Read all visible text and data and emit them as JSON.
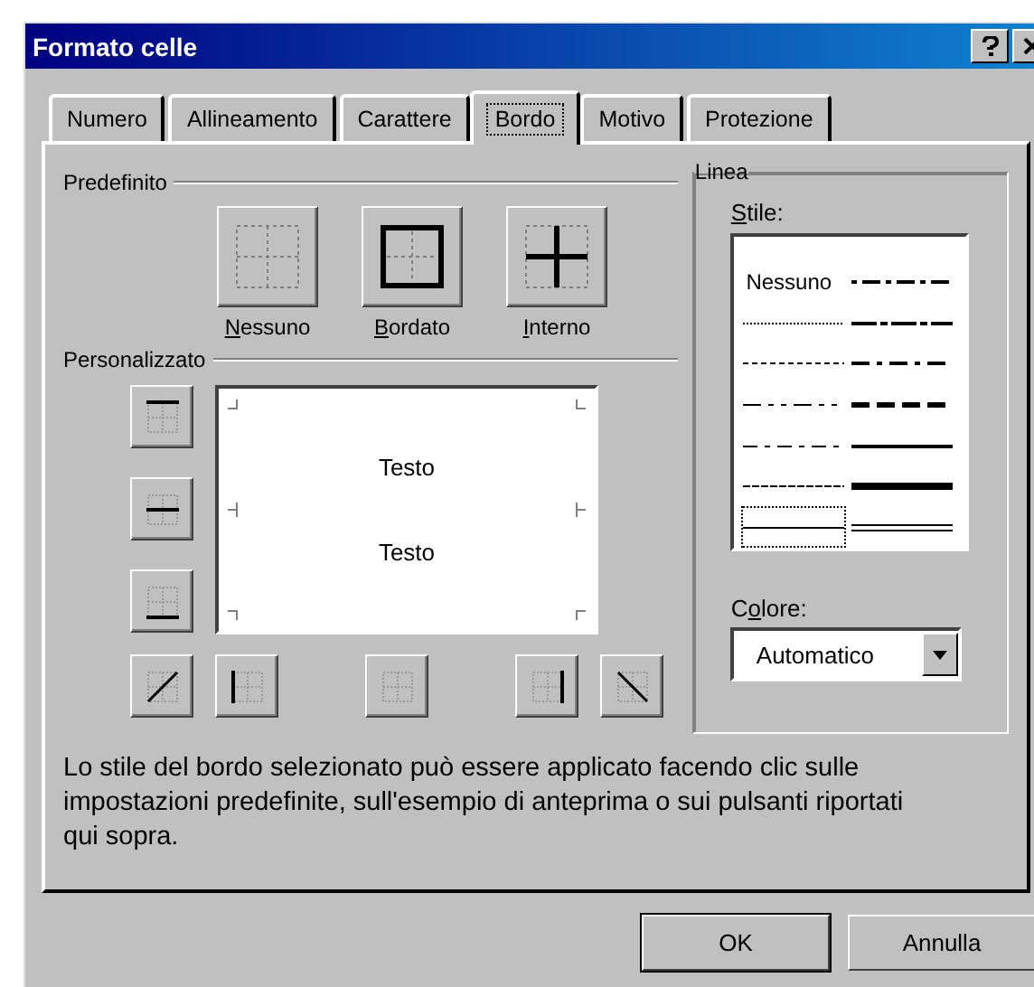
{
  "window": {
    "title": "Formato celle"
  },
  "tabs": [
    {
      "label": "Numero",
      "selected": false
    },
    {
      "label": "Allineamento",
      "selected": false
    },
    {
      "label": "Carattere",
      "selected": false
    },
    {
      "label": "Bordo",
      "selected": true
    },
    {
      "label": "Motivo",
      "selected": false
    },
    {
      "label": "Protezione",
      "selected": false
    }
  ],
  "presets": {
    "title": "Predefinito",
    "items": [
      {
        "label": "Nessuno",
        "kind": "none"
      },
      {
        "label": "Bordato",
        "kind": "outline"
      },
      {
        "label": "Interno",
        "kind": "inside"
      }
    ]
  },
  "custom": {
    "title": "Personalizzato",
    "preview_texts": [
      "Testo",
      "Testo"
    ]
  },
  "line": {
    "title": "Linea",
    "style_label": "Stile:",
    "styles": [
      {
        "label": "Nessuno",
        "selected": false
      },
      {
        "selected": false
      },
      {
        "selected": false
      },
      {
        "selected": false
      },
      {
        "selected": false
      },
      {
        "selected": false
      },
      {
        "selected": true
      },
      {
        "selected": false
      },
      {
        "selected": false
      },
      {
        "selected": false
      },
      {
        "selected": false
      },
      {
        "selected": false
      },
      {
        "selected": false
      },
      {
        "selected": false
      }
    ],
    "color_label": "Colore:",
    "color_value": "Automatico"
  },
  "description": "Lo stile del bordo selezionato può essere applicato facendo clic sulle impostazioni predefinite, sull'esempio di anteprima o sui pulsanti riportati qui sopra.",
  "buttons": [
    "OK",
    "Annulla"
  ]
}
